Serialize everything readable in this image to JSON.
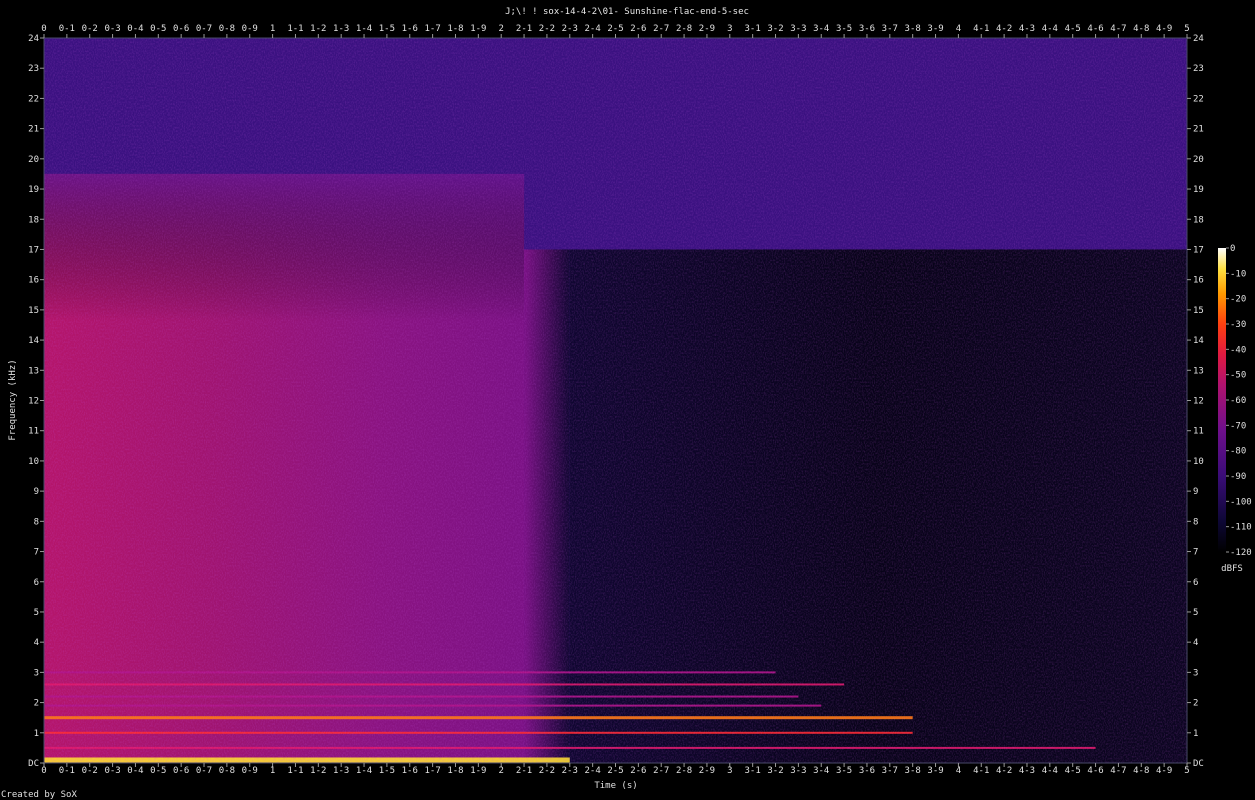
{
  "chart_data": {
    "type": "heatmap",
    "title": "J;\\! ! sox-14-4-2\\01- Sunshine-flac-end-5-sec",
    "xlabel": "Time (s)",
    "ylabel": "Frequency (kHz)",
    "xlim": [
      0,
      5
    ],
    "ylim": [
      0,
      24
    ],
    "x_ticks": [
      "0",
      "0-1",
      "0-2",
      "0-3",
      "0-4",
      "0-5",
      "0-6",
      "0-7",
      "0-8",
      "0-9",
      "1",
      "1-1",
      "1-2",
      "1-3",
      "1-4",
      "1-5",
      "1-6",
      "1-7",
      "1-8",
      "1-9",
      "2",
      "2-1",
      "2-2",
      "2-3",
      "2-4",
      "2-5",
      "2-6",
      "2-7",
      "2-8",
      "2-9",
      "3",
      "3-1",
      "3-2",
      "3-3",
      "3-4",
      "3-5",
      "3-6",
      "3-7",
      "3-8",
      "3-9",
      "4",
      "4-1",
      "4-2",
      "4-3",
      "4-4",
      "4-5",
      "4-6",
      "4-7",
      "4-8",
      "4-9",
      "5"
    ],
    "y_ticks": [
      "DC",
      "1",
      "2",
      "3",
      "4",
      "5",
      "6",
      "7",
      "8",
      "9",
      "10",
      "11",
      "12",
      "13",
      "14",
      "15",
      "16",
      "17",
      "18",
      "19",
      "20",
      "21",
      "22",
      "23",
      "24"
    ],
    "colorbar": {
      "label": "dBFS",
      "range": [
        -120,
        0
      ],
      "ticks": [
        "0",
        "-10",
        "-20",
        "-30",
        "-40",
        "-50",
        "-60",
        "-70",
        "-80",
        "-90",
        "-100",
        "-110",
        "-120"
      ]
    },
    "bands": [
      {
        "freq_khz": 0.1,
        "end_s": 2.3,
        "level_dbfs": -5
      },
      {
        "freq_khz": 0.5,
        "end_s": 4.6,
        "level_dbfs": -60
      },
      {
        "freq_khz": 1.0,
        "end_s": 3.8,
        "level_dbfs": -45
      },
      {
        "freq_khz": 1.5,
        "end_s": 3.8,
        "level_dbfs": -25
      },
      {
        "freq_khz": 1.9,
        "end_s": 3.4,
        "level_dbfs": -65
      },
      {
        "freq_khz": 2.2,
        "end_s": 3.3,
        "level_dbfs": -65
      },
      {
        "freq_khz": 2.6,
        "end_s": 3.5,
        "level_dbfs": -60
      },
      {
        "freq_khz": 3.0,
        "end_s": 3.2,
        "level_dbfs": -65
      }
    ],
    "regions": [
      {
        "t_start": 0,
        "t_end": 2.1,
        "f_start": 0,
        "f_end": 19.5,
        "level_dbfs": -70
      },
      {
        "t_start": 2.1,
        "t_end": 5,
        "f_start": 0,
        "f_end": 17,
        "level_dbfs": -115
      },
      {
        "t_start": 0,
        "t_end": 5,
        "f_start": 19.5,
        "f_end": 24,
        "level_dbfs": -95
      }
    ]
  },
  "footer": {
    "credit": "Created by SoX"
  }
}
